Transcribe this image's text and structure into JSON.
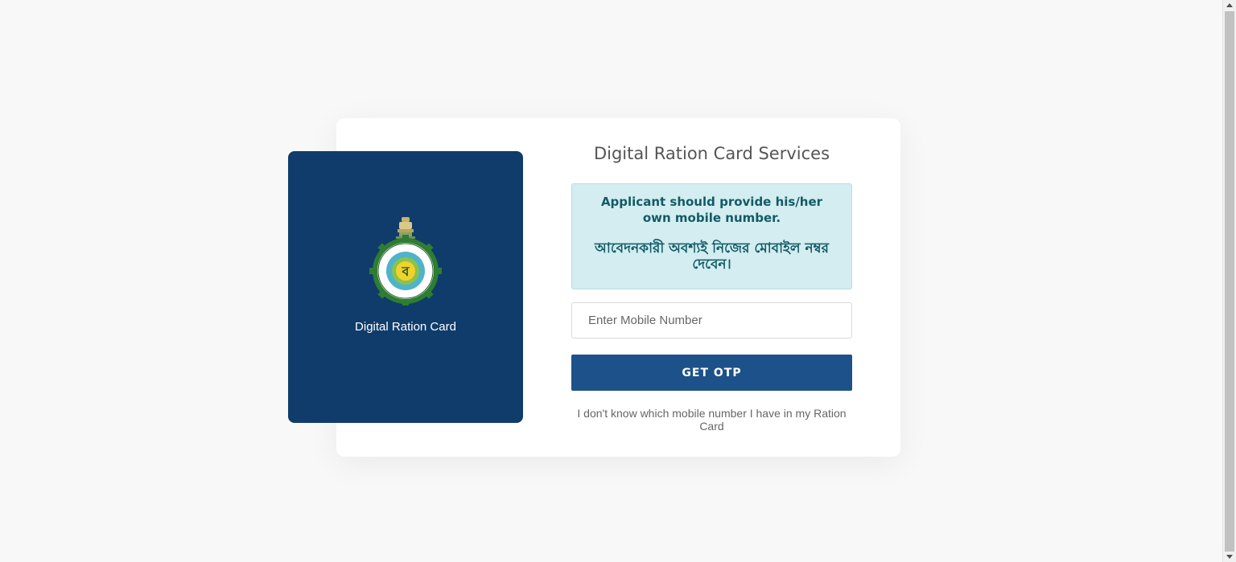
{
  "brand": {
    "label": "Digital Ration Card",
    "emblem": "west-bengal-govt-emblem-icon",
    "panel_color": "#0f3c6b"
  },
  "form": {
    "title": "Digital Ration Card Services",
    "notice_en": "Applicant should provide his/her own mobile number.",
    "notice_bn": "আবেদনকারী অবশ্যই নিজের মোবাইল নম্বর দেবেন।",
    "mobile_placeholder": "Enter Mobile Number",
    "mobile_value": "",
    "otp_button": "GET OTP",
    "help_link": "I don't know which mobile number I have in my Ration Card"
  },
  "colors": {
    "accent": "#1d5189",
    "notice_bg": "#d3edf0",
    "notice_text": "#125b66"
  }
}
